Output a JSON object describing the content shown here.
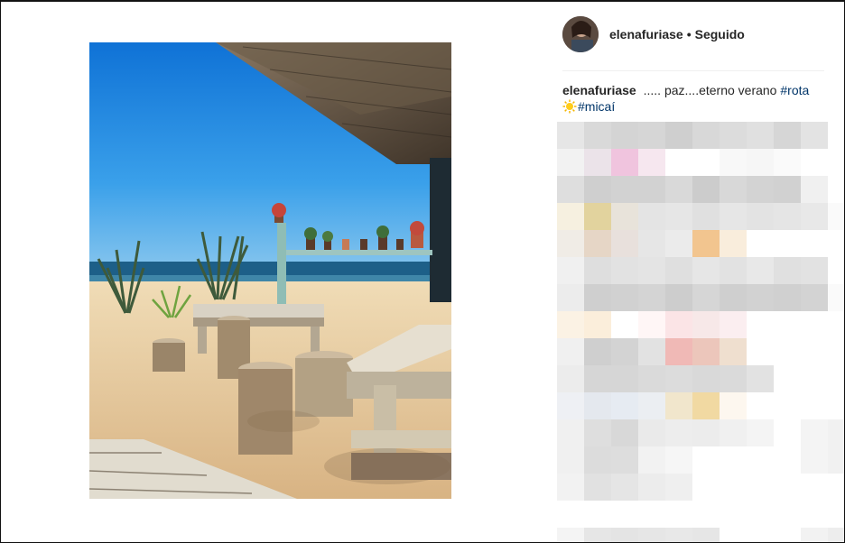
{
  "post": {
    "username": "elenafuriase",
    "separator": "•",
    "follow_status": "Seguido",
    "caption": {
      "username": "elenafuriase",
      "text": "..... paz....eterno verano",
      "hashtags": [
        "#rota",
        "#micaí"
      ],
      "emoji": "sun-emoji"
    }
  },
  "icons": {
    "avatar": "profile-photo",
    "emoji": "sun-icon"
  },
  "colors": {
    "hashtag": "#003569",
    "text": "#262626",
    "divider": "#efefef",
    "sky": "#1f86e0",
    "sand": "#e9cfa3"
  }
}
